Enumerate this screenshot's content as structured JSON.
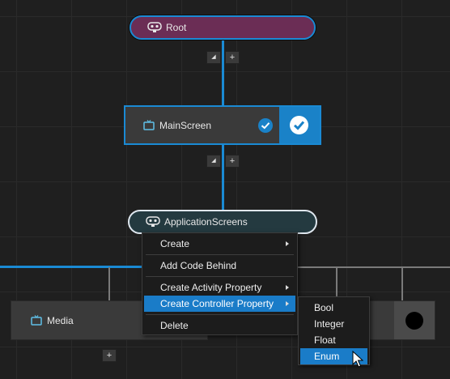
{
  "nodes": {
    "root": {
      "label": "Root",
      "icon": "robot-icon"
    },
    "main_screen": {
      "label": "MainScreen",
      "icon": "tv-icon"
    },
    "application_screens": {
      "label": "ApplicationScreens",
      "icon": "robot-icon"
    },
    "media": {
      "label": "Media",
      "icon": "tv-icon"
    }
  },
  "node_buttons": {
    "collapse": "◢",
    "add": "+"
  },
  "context_menu": {
    "items": [
      {
        "label": "Create",
        "has_submenu": true
      },
      {
        "label": "Add Code Behind",
        "has_submenu": false
      },
      {
        "label": "Create Activity Property",
        "has_submenu": true
      },
      {
        "label": "Create Controller Property",
        "has_submenu": true,
        "highlighted": true
      },
      {
        "label": "Delete",
        "has_submenu": false
      }
    ]
  },
  "submenu": {
    "items": [
      {
        "label": "Bool"
      },
      {
        "label": "Integer"
      },
      {
        "label": "Float"
      },
      {
        "label": "Enum",
        "highlighted": true
      }
    ]
  },
  "colors": {
    "accent": "#1a82c8",
    "root_fill": "#6b2d55",
    "app_screens_fill": "#243a40",
    "menu_bg": "#1c1c1c"
  }
}
